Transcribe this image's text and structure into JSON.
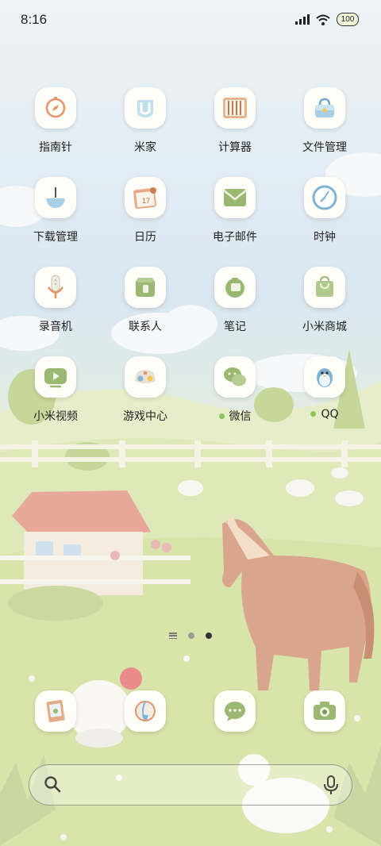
{
  "status_bar": {
    "time": "8:16",
    "battery": "100"
  },
  "apps": [
    {
      "label": "指南针",
      "icon": "compass-icon"
    },
    {
      "label": "米家",
      "icon": "mijia-icon"
    },
    {
      "label": "计算器",
      "icon": "calculator-icon"
    },
    {
      "label": "文件管理",
      "icon": "file-manager-icon"
    },
    {
      "label": "下载管理",
      "icon": "download-icon"
    },
    {
      "label": "日历",
      "icon": "calendar-icon",
      "calendar_day": "17"
    },
    {
      "label": "电子邮件",
      "icon": "mail-icon"
    },
    {
      "label": "时钟",
      "icon": "clock-icon"
    },
    {
      "label": "录音机",
      "icon": "recorder-icon"
    },
    {
      "label": "联系人",
      "icon": "contacts-icon"
    },
    {
      "label": "笔记",
      "icon": "notes-icon"
    },
    {
      "label": "小米商城",
      "icon": "shop-bag-icon"
    },
    {
      "label": "小米视频",
      "icon": "video-icon"
    },
    {
      "label": "游戏中心",
      "icon": "game-center-icon"
    },
    {
      "label": "微信",
      "icon": "wechat-icon",
      "notification": true
    },
    {
      "label": "QQ",
      "icon": "qq-penguin-icon",
      "notification": true
    }
  ],
  "page_indicator": {
    "pages": 2,
    "active_page": 2
  },
  "dock": [
    {
      "icon": "gallery-icon"
    },
    {
      "icon": "browser-icon"
    },
    {
      "icon": "messages-icon"
    },
    {
      "icon": "camera-icon"
    }
  ],
  "search": {
    "placeholder": ""
  },
  "colors": {
    "sky": "#dce9f2",
    "grass": "#dce6b4",
    "accent_green": "#8dc25a",
    "icon_tile": "#fffdf7"
  }
}
